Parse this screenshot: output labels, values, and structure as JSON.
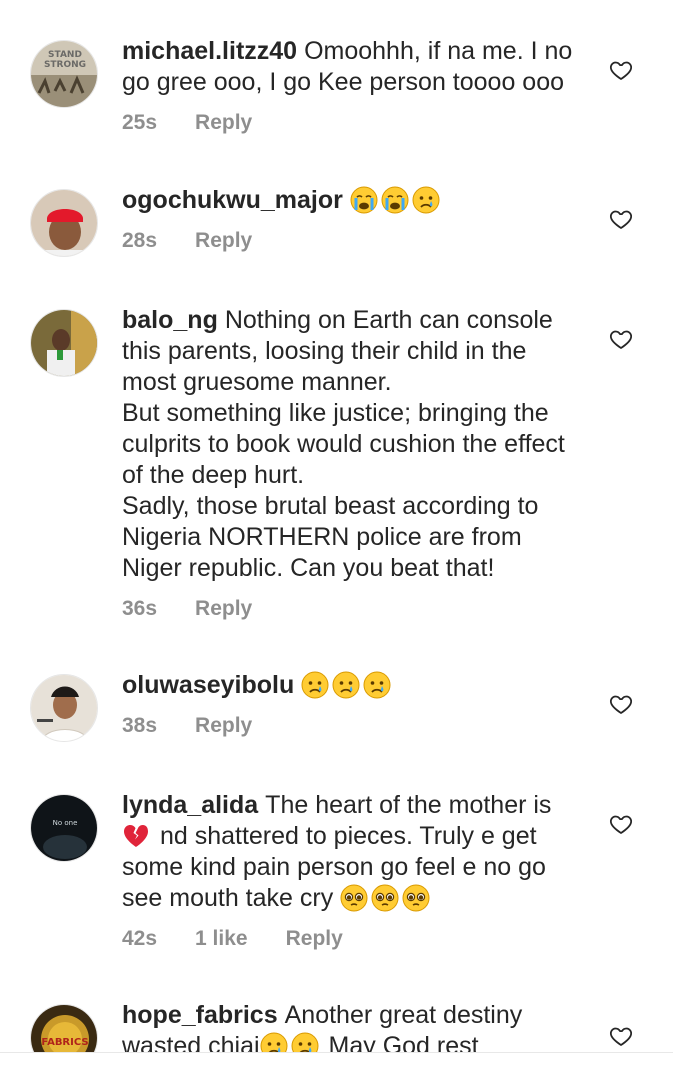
{
  "comments": [
    {
      "username": "michael.litzz40",
      "text": "Omoohhh, if na me. I no go gree ooo, I go Kee person toooo ooo",
      "time": "25s",
      "reply": "Reply"
    },
    {
      "username": "ogochukwu_major",
      "text": "",
      "time": "28s",
      "reply": "Reply"
    },
    {
      "username": "balo_ng",
      "text": "Nothing on Earth can console this parents, loosing their child in the most gruesome manner.",
      "text2": "But something like justice; bringing the culprits to book would cushion the effect of the deep hurt.",
      "text3": "Sadly, those brutal beast according to Nigeria NORTHERN police are from Niger republic. Can you beat that!",
      "time": "36s",
      "reply": "Reply"
    },
    {
      "username": "oluwaseyibolu",
      "text": "",
      "time": "38s",
      "reply": "Reply"
    },
    {
      "username": "lynda_alida",
      "text_a": "The heart of the mother is",
      "text_b": "nd shattered to pieces. Truly e get some kind pain person go feel e no go see mouth take cry",
      "time": "42s",
      "likes": "1 like",
      "reply": "Reply"
    },
    {
      "username": "hope_fabrics",
      "text_a": "Another great destiny wasted chiai",
      "text_b": "May God rest"
    }
  ],
  "avatars": {
    "michael": "STAND STRONG",
    "lynda": "No one",
    "hope": "FABRICS"
  }
}
